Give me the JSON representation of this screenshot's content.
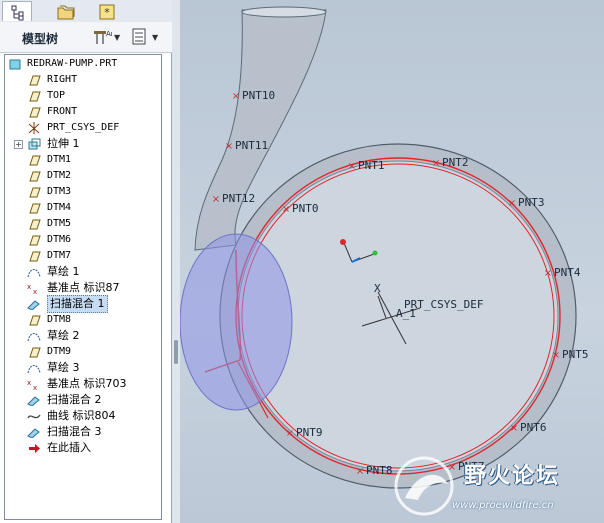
{
  "tabs": [
    {
      "name": "model-tree-tab",
      "icon": "tree-structure-icon",
      "active": true
    },
    {
      "name": "folder-browser-tab",
      "icon": "folder-icon",
      "active": false
    },
    {
      "name": "favorites-tab",
      "icon": "star-icon",
      "active": false
    }
  ],
  "panel": {
    "title": "模型树",
    "settings_icon": "tree-settings-icon",
    "show_icon": "show-columns-icon"
  },
  "tree": {
    "root": "REDRAW-PUMP.PRT",
    "items": [
      {
        "label": "RIGHT",
        "icon": "datum-plane-icon",
        "mono": true
      },
      {
        "label": "TOP",
        "icon": "datum-plane-icon",
        "mono": true
      },
      {
        "label": "FRONT",
        "icon": "datum-plane-icon",
        "mono": true
      },
      {
        "label": "PRT_CSYS_DEF",
        "icon": "csys-icon",
        "mono": true
      },
      {
        "label": "拉伸 1",
        "icon": "extrude-icon",
        "mono": false,
        "expandable": true
      },
      {
        "label": "DTM1",
        "icon": "datum-plane-icon",
        "mono": true
      },
      {
        "label": "DTM2",
        "icon": "datum-plane-icon",
        "mono": true
      },
      {
        "label": "DTM3",
        "icon": "datum-plane-icon",
        "mono": true
      },
      {
        "label": "DTM4",
        "icon": "datum-plane-icon",
        "mono": true
      },
      {
        "label": "DTM5",
        "icon": "datum-plane-icon",
        "mono": true
      },
      {
        "label": "DTM6",
        "icon": "datum-plane-icon",
        "mono": true
      },
      {
        "label": "DTM7",
        "icon": "datum-plane-icon",
        "mono": true
      },
      {
        "label": "草绘 1",
        "icon": "sketch-icon",
        "mono": false
      },
      {
        "label": "基准点 标识87",
        "icon": "datum-point-icon",
        "mono": false
      },
      {
        "label": "扫描混合 1",
        "icon": "swept-blend-icon",
        "mono": false,
        "selected": true
      },
      {
        "label": "DTM8",
        "icon": "datum-plane-icon",
        "mono": true
      },
      {
        "label": "草绘 2",
        "icon": "sketch-icon",
        "mono": false
      },
      {
        "label": "DTM9",
        "icon": "datum-plane-icon",
        "mono": true
      },
      {
        "label": "草绘 3",
        "icon": "sketch-icon",
        "mono": false
      },
      {
        "label": "基准点 标识703",
        "icon": "datum-point-icon",
        "mono": false
      },
      {
        "label": "扫描混合 2",
        "icon": "swept-blend-icon",
        "mono": false
      },
      {
        "label": "曲线 标识804",
        "icon": "curve-icon",
        "mono": false
      },
      {
        "label": "扫描混合 3",
        "icon": "swept-blend-icon",
        "mono": false
      },
      {
        "label": "在此插入",
        "icon": "insert-here-arrow-icon",
        "mono": false
      }
    ]
  },
  "viewport": {
    "point_labels": [
      "PNT10",
      "PNT11",
      "PNT12",
      "PNT0",
      "PNT1",
      "PNT2",
      "PNT3",
      "PNT4",
      "PNT5",
      "PNT6",
      "PNT7",
      "PNT8",
      "PNT9"
    ],
    "csys_label": "PRT_CSYS_DEF",
    "axis_label": "A_1",
    "axis_letter_x": "X",
    "colors": {
      "background": "#c3cfdb",
      "body_fill": "#cdd5df",
      "edge_red": "#e0262c",
      "highlight_blue": "#8f93e6"
    }
  },
  "watermark": {
    "title": "野火论坛",
    "url": "www.proewildfire.cn"
  }
}
